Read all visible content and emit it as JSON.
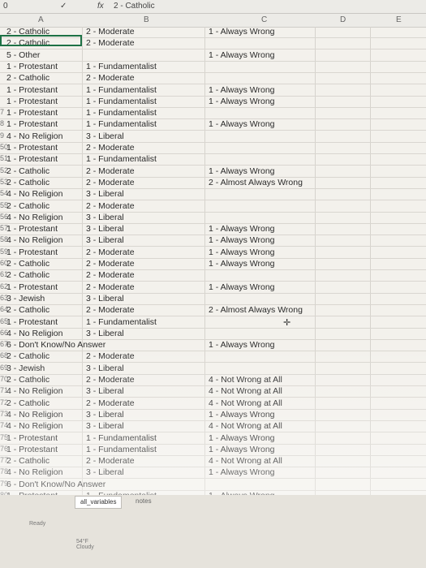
{
  "formula_bar": {
    "name_box": "0",
    "check": "✓",
    "fx": "fx",
    "value": "2 - Catholic"
  },
  "columns": [
    "A",
    "B",
    "C",
    "D",
    "E"
  ],
  "rows": [
    {
      "n": "",
      "a": "2 - Catholic",
      "b": "2 - Moderate",
      "c": "1 - Always Wrong"
    },
    {
      "n": "",
      "a": "2 - Catholic",
      "b": "2 - Moderate",
      "c": ""
    },
    {
      "n": "",
      "a": "5 - Other",
      "b": "",
      "c": "1 - Always Wrong"
    },
    {
      "n": "",
      "a": "1 - Protestant",
      "b": "1 - Fundamentalist",
      "c": ""
    },
    {
      "n": "",
      "a": "2 - Catholic",
      "b": "2 - Moderate",
      "c": ""
    },
    {
      "n": "",
      "a": "1 - Protestant",
      "b": "1 - Fundamentalist",
      "c": "1 - Always Wrong"
    },
    {
      "n": "",
      "a": "1 - Protestant",
      "b": "1 - Fundamentalist",
      "c": "1 - Always Wrong"
    },
    {
      "n": "7",
      "a": "1 - Protestant",
      "b": "1 - Fundamentalist",
      "c": ""
    },
    {
      "n": "8",
      "a": "1 - Protestant",
      "b": "1 - Fundamentalist",
      "c": "1 - Always Wrong"
    },
    {
      "n": "9",
      "a": "4 - No Religion",
      "b": "3 - Liberal",
      "c": ""
    },
    {
      "n": "50",
      "a": "1 - Protestant",
      "b": "2 - Moderate",
      "c": ""
    },
    {
      "n": "51",
      "a": "1 - Protestant",
      "b": "1 - Fundamentalist",
      "c": ""
    },
    {
      "n": "52",
      "a": "2 - Catholic",
      "b": "2 - Moderate",
      "c": "1 - Always Wrong"
    },
    {
      "n": "53",
      "a": "2 - Catholic",
      "b": "2 - Moderate",
      "c": "2 - Almost Always Wrong"
    },
    {
      "n": "54",
      "a": "4 - No Religion",
      "b": "3 - Liberal",
      "c": ""
    },
    {
      "n": "55",
      "a": "2 - Catholic",
      "b": "2 - Moderate",
      "c": ""
    },
    {
      "n": "56",
      "a": "4 - No Religion",
      "b": "3 - Liberal",
      "c": ""
    },
    {
      "n": "57",
      "a": "1 - Protestant",
      "b": "3 - Liberal",
      "c": "1 - Always Wrong"
    },
    {
      "n": "58",
      "a": "4 - No Religion",
      "b": "3 - Liberal",
      "c": "1 - Always Wrong"
    },
    {
      "n": "59",
      "a": "1 - Protestant",
      "b": "2 - Moderate",
      "c": "1 - Always Wrong"
    },
    {
      "n": "60",
      "a": "2 - Catholic",
      "b": "2 - Moderate",
      "c": "1 - Always Wrong"
    },
    {
      "n": "61",
      "a": "2 - Catholic",
      "b": "2 - Moderate",
      "c": ""
    },
    {
      "n": "62",
      "a": "1 - Protestant",
      "b": "2 - Moderate",
      "c": "1 - Always Wrong"
    },
    {
      "n": "63",
      "a": "3 - Jewish",
      "b": "3 - Liberal",
      "c": ""
    },
    {
      "n": "64",
      "a": "2 - Catholic",
      "b": "2 - Moderate",
      "c": "2 - Almost Always Wrong"
    },
    {
      "n": "65",
      "a": "1 - Protestant",
      "b": "1 - Fundamentalist",
      "c": ""
    },
    {
      "n": "66",
      "a": "4 - No Religion",
      "b": "3 - Liberal",
      "c": ""
    },
    {
      "n": "67",
      "a": "6 - Don't Know/No Answer",
      "b": "",
      "c": "1 - Always Wrong"
    },
    {
      "n": "68",
      "a": "2 - Catholic",
      "b": "2 - Moderate",
      "c": ""
    },
    {
      "n": "69",
      "a": "3 - Jewish",
      "b": "3 - Liberal",
      "c": ""
    },
    {
      "n": "70",
      "a": "2 - Catholic",
      "b": "2 - Moderate",
      "c": "4 - Not Wrong at All"
    },
    {
      "n": "71",
      "a": "4 - No Religion",
      "b": "3 - Liberal",
      "c": "4 - Not Wrong at All"
    },
    {
      "n": "72",
      "a": "2 - Catholic",
      "b": "2 - Moderate",
      "c": "4 - Not Wrong at All"
    },
    {
      "n": "73",
      "a": "4 - No Religion",
      "b": "3 - Liberal",
      "c": "1 - Always Wrong"
    },
    {
      "n": "74",
      "a": "4 - No Religion",
      "b": "3 - Liberal",
      "c": "4 - Not Wrong at All"
    },
    {
      "n": "75",
      "a": "1 - Protestant",
      "b": "1 - Fundamentalist",
      "c": "1 - Always Wrong"
    },
    {
      "n": "76",
      "a": "1 - Protestant",
      "b": "1 - Fundamentalist",
      "c": "1 - Always Wrong"
    },
    {
      "n": "77",
      "a": "2 - Catholic",
      "b": "2 - Moderate",
      "c": "4 - Not Wrong at All"
    },
    {
      "n": "78",
      "a": "4 - No Religion",
      "b": "3 - Liberal",
      "c": "1 - Always Wrong"
    },
    {
      "n": "79",
      "a": "6 - Don't Know/No Answer",
      "b": "",
      "c": ""
    },
    {
      "n": "80",
      "a": "1 - Protestant",
      "b": "1 - Fundamentalist",
      "c": "1 - Always Wrong"
    }
  ],
  "sheet_tabs": {
    "active": "all_variables",
    "other": "notes"
  },
  "status": {
    "ready": "Ready",
    "temp": "54°F",
    "weather": "Cloudy"
  }
}
